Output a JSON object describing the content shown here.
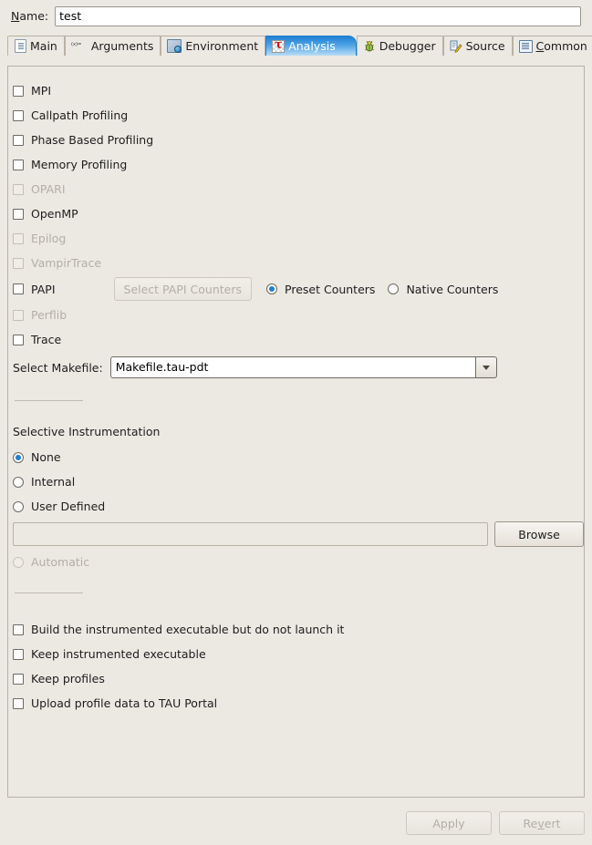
{
  "name_row": {
    "label_prefix": "N",
    "label_rest": "ame:",
    "value": "test",
    "placeholder": ""
  },
  "tabs": [
    {
      "id": "main",
      "label": "Main",
      "icon": "document-icon",
      "selected": false
    },
    {
      "id": "arguments",
      "label": "Arguments",
      "icon": "variable-icon",
      "selected": false
    },
    {
      "id": "environment",
      "label": "Environment",
      "icon": "environment-icon",
      "selected": false
    },
    {
      "id": "analysis",
      "label": "Analysis",
      "icon": "tau-icon",
      "selected": true
    },
    {
      "id": "debugger",
      "label": "Debugger",
      "icon": "bug-icon",
      "selected": false
    },
    {
      "id": "source",
      "label": "Source",
      "icon": "source-icon",
      "selected": false
    },
    {
      "id": "common",
      "label": "Common",
      "icon": "common-icon",
      "selected": false
    }
  ],
  "tab_mnemonics": {
    "common_first": "C",
    "common_rest": "ommon"
  },
  "analysis": {
    "feature_checkboxes": [
      {
        "id": "mpi",
        "label": "MPI",
        "checked": false,
        "enabled": true
      },
      {
        "id": "callpath",
        "label": "Callpath Profiling",
        "checked": false,
        "enabled": true
      },
      {
        "id": "phase-based",
        "label": "Phase Based Profiling",
        "checked": false,
        "enabled": true
      },
      {
        "id": "memory-profiling",
        "label": "Memory Profiling",
        "checked": false,
        "enabled": true
      },
      {
        "id": "opari",
        "label": "OPARI",
        "checked": false,
        "enabled": false
      },
      {
        "id": "openmp",
        "label": "OpenMP",
        "checked": false,
        "enabled": true
      },
      {
        "id": "epilog",
        "label": "Epilog",
        "checked": false,
        "enabled": false
      },
      {
        "id": "vampirtrace",
        "label": "VampirTrace",
        "checked": false,
        "enabled": false
      }
    ],
    "papi": {
      "checkbox_label": "PAPI",
      "checked": false,
      "select_counters_button": "Select PAPI Counters",
      "select_counters_enabled": false,
      "radios": [
        {
          "id": "preset-counters",
          "label": "Preset Counters",
          "selected": true
        },
        {
          "id": "native-counters",
          "label": "Native Counters",
          "selected": false
        }
      ]
    },
    "post_papi_checkboxes": [
      {
        "id": "perflib",
        "label": "Perflib",
        "checked": false,
        "enabled": false
      },
      {
        "id": "trace",
        "label": "Trace",
        "checked": false,
        "enabled": true
      }
    ],
    "makefile": {
      "label": "Select Makefile:",
      "value": "Makefile.tau-pdt"
    },
    "selective_instrumentation": {
      "title": "Selective Instrumentation",
      "radios": [
        {
          "id": "none",
          "label": "None",
          "selected": true,
          "enabled": true
        },
        {
          "id": "internal",
          "label": "Internal",
          "selected": false,
          "enabled": true
        },
        {
          "id": "user-defined",
          "label": "User Defined",
          "selected": false,
          "enabled": true
        },
        {
          "id": "automatic",
          "label": "Automatic",
          "selected": false,
          "enabled": false
        }
      ],
      "file_field_value": "",
      "file_field_enabled": false,
      "browse_button": "Browse"
    },
    "output_checkboxes": [
      {
        "id": "build-no-launch",
        "label": "Build the instrumented executable but do not launch it",
        "checked": false
      },
      {
        "id": "keep-instrumented",
        "label": "Keep instrumented executable",
        "checked": false
      },
      {
        "id": "keep-profiles",
        "label": "Keep profiles",
        "checked": false
      },
      {
        "id": "upload-profile-data",
        "label": "Upload profile data to TAU Portal",
        "checked": false
      }
    ]
  },
  "footer": {
    "apply": {
      "label": "Apply",
      "enabled": false
    },
    "revert": {
      "prefix": "Re",
      "mnemonic": "v",
      "suffix": "ert",
      "label": "Revert",
      "enabled": false
    }
  }
}
